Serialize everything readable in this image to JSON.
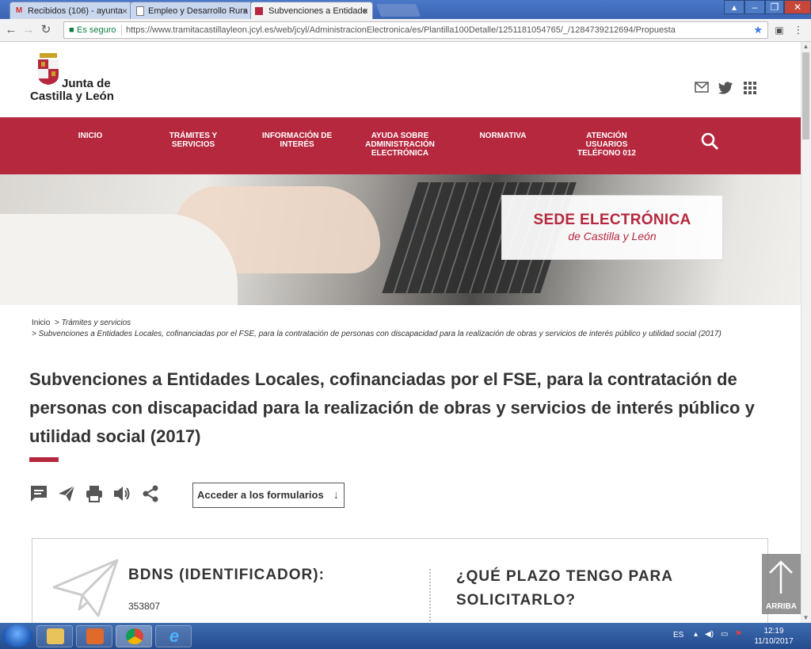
{
  "browser": {
    "tabs": [
      {
        "label": "Recibidos (106) - ayunta",
        "favicon": "gmail-icon",
        "active": false
      },
      {
        "label": "Empleo y Desarrollo Rura",
        "favicon": "page-icon",
        "active": false
      },
      {
        "label": "Subvenciones a Entidade",
        "favicon": "jcyl-icon",
        "active": true
      }
    ],
    "secure_label": "Es seguro",
    "url": "https://www.tramitacastillayleon.jcyl.es/web/jcyl/AdministracionElectronica/es/Plantilla100Detalle/1251181054765/_/1284739212694/Propuesta"
  },
  "site": {
    "logo_line1": "Junta de",
    "logo_line2": "Castilla y León",
    "nav": [
      {
        "label": "INICIO"
      },
      {
        "label": "TRÁMITES Y SERVICIOS"
      },
      {
        "label": "INFORMACIÓN DE INTERÉS"
      },
      {
        "label": "AYUDA SOBRE ADMINISTRACIÓN ELECTRÓNICA"
      },
      {
        "label": "NORMATIVA"
      },
      {
        "label": "ATENCIÓN USUARIOS TELÉFONO 012"
      }
    ],
    "banner_title": "SEDE ELECTRÓNICA",
    "banner_subtitle": "de Castilla y León"
  },
  "breadcrumb": {
    "home": "Inicio",
    "level1": "> Trámites y servicios",
    "level2": "> Subvenciones a Entidades Locales, cofinanciadas por el FSE, para la contratación de personas con discapacidad para la realización de obras y servicios de interés público y utilidad social (2017)"
  },
  "page_title": "Subvenciones a Entidades Locales, cofinanciadas por el FSE, para la contratación de personas con discapacidad para la realización de obras y servicios de interés público y utilidad social (2017)",
  "access_button": "Acceder a los formularios",
  "card": {
    "bdns_label": "BDNS (IDENTIFICADOR):",
    "bdns_value": "353807",
    "plazo_label": "¿QUÉ PLAZO TENGO PARA SOLICITARLO?"
  },
  "back_to_top": "ARRIBA",
  "taskbar": {
    "lang": "ES",
    "time": "12:19",
    "date": "11/10/2017"
  },
  "colors": {
    "brand": "#b5283e"
  }
}
